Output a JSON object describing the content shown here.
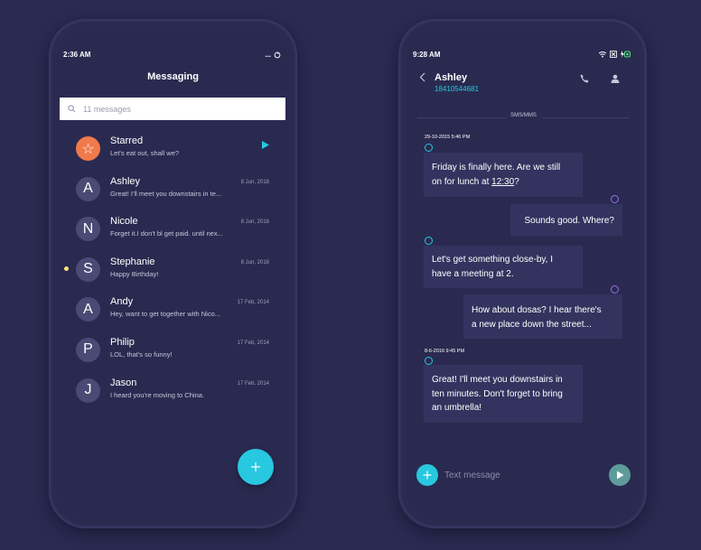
{
  "left_phone": {
    "status_time": "2:36 AM",
    "status_overflow": "...",
    "title": "Messaging",
    "search_placeholder": "11 messages",
    "conversations": [
      {
        "initial": "☆",
        "name": "Starred",
        "preview": "Let's eat out, shall we?",
        "date": "",
        "starred": true
      },
      {
        "initial": "A",
        "name": "Ashley",
        "preview": "Great! I'll meet you downstairs in te...",
        "date": "8 Jun, 2016"
      },
      {
        "initial": "N",
        "name": "Nicole",
        "preview": "Forget it.I don't bl get paid. until nex...",
        "date": "8 Jun, 2016"
      },
      {
        "initial": "S",
        "name": "Stephanie",
        "preview": "Happy Birthday!",
        "date": "8 Jun, 2016",
        "unread": true
      },
      {
        "initial": "A",
        "name": "Andy",
        "preview": "Hey, want to get together with Nico...",
        "date": "17 Feb, 2014"
      },
      {
        "initial": "P",
        "name": "Philip",
        "preview": "LOL, that's so funny!",
        "date": "17 Feb, 2014"
      },
      {
        "initial": "J",
        "name": "Jason",
        "preview": "I heard you're moving to China.",
        "date": "17 Feb, 2014"
      }
    ],
    "fab_icon": "plus-icon"
  },
  "right_phone": {
    "status_time": "9:28 AM",
    "contact_name": "Ashley",
    "contact_number": "18410544681",
    "divider_label": "SMS/MMS",
    "timestamp_1": "29-10-2015 5:46 PM",
    "msg_1_line1": "Friday is finally here. Are we still",
    "msg_1_line2_before": "on for lunch at ",
    "msg_1_line2_link": "12:30",
    "msg_1_line2_after": "?",
    "msg_2": "Sounds good. Where?",
    "msg_3_line1": "Let's get something close-by, I",
    "msg_3_line2": "have a meeting at 2.",
    "msg_4_line1": "How about dosas? I hear there's",
    "msg_4_line2": "a new place down the street...",
    "timestamp_2": "8-6-2016 9:45 PM",
    "msg_5_line1": "Great! I'll meet you downstairs in",
    "msg_5_line2": "ten minutes. Don't forget to bring",
    "msg_5_line3": "an umbrella!",
    "input_placeholder": "Text message"
  },
  "colors": {
    "background": "#2b2b52",
    "accent": "#27c8e0",
    "starred": "#f07a4a",
    "bubble": "#33335f",
    "outgoing_marker": "#9a6ee6",
    "unread_dot": "#f7e47a"
  }
}
